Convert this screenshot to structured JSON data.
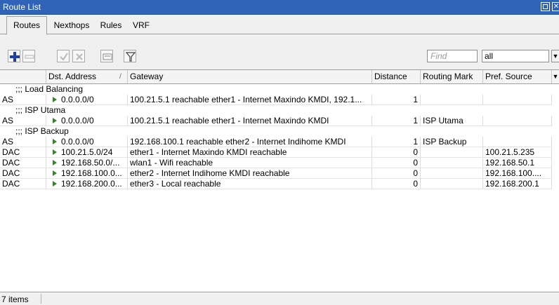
{
  "window": {
    "title": "Route List",
    "close_glyph": "✕"
  },
  "tabs": [
    {
      "label": "Routes",
      "active": true
    },
    {
      "label": "Nexthops",
      "active": false
    },
    {
      "label": "Rules",
      "active": false
    },
    {
      "label": "VRF",
      "active": false
    }
  ],
  "toolbar": {
    "buttons": [
      "add-icon",
      "remove-icon",
      "enable-icon",
      "disable-icon",
      "comment-icon",
      "filter-icon"
    ],
    "find_placeholder": "Find",
    "filter_value": "all",
    "dropdown_glyph": "▼"
  },
  "columns": {
    "flags": "",
    "dst": "Dst. Address",
    "sort": "/",
    "gateway": "Gateway",
    "distance": "Distance",
    "routing_mark": "Routing Mark",
    "pref_source": "Pref. Source",
    "menu_glyph": "▼"
  },
  "groups": [
    {
      "comment": ";;; Load Balancing",
      "row": {
        "flags": "AS",
        "dst": "0.0.0.0/0",
        "gateway": "100.21.5.1 reachable ether1 - Internet Maxindo KMDI, 192.1...",
        "distance": "1",
        "routing_mark": "",
        "pref_source": ""
      }
    },
    {
      "comment": ";;; ISP Utama",
      "row": {
        "flags": "AS",
        "dst": "0.0.0.0/0",
        "gateway": "100.21.5.1 reachable ether1 - Internet Maxindo KMDI",
        "distance": "1",
        "routing_mark": "ISP Utama",
        "pref_source": ""
      }
    },
    {
      "comment": ";;; ISP Backup",
      "row": {
        "flags": "AS",
        "dst": "0.0.0.0/0",
        "gateway": "192.168.100.1 reachable ether2 - Internet Indihome KMDI",
        "distance": "1",
        "routing_mark": "ISP Backup",
        "pref_source": ""
      }
    }
  ],
  "rows": [
    {
      "flags": "DAC",
      "dst": "100.21.5.0/24",
      "gateway": "ether1 - Internet Maxindo KMDI reachable",
      "distance": "0",
      "routing_mark": "",
      "pref_source": "100.21.5.235"
    },
    {
      "flags": "DAC",
      "dst": "192.168.50.0/...",
      "gateway": "wlan1 - Wifi reachable",
      "distance": "0",
      "routing_mark": "",
      "pref_source": "192.168.50.1"
    },
    {
      "flags": "DAC",
      "dst": "192.168.100.0...",
      "gateway": "ether2 - Internet Indihome KMDI reachable",
      "distance": "0",
      "routing_mark": "",
      "pref_source": "192.168.100...."
    },
    {
      "flags": "DAC",
      "dst": "192.168.200.0...",
      "gateway": "ether3 - Local reachable",
      "distance": "0",
      "routing_mark": "",
      "pref_source": "192.168.200.1"
    }
  ],
  "status": {
    "count_text": "7 items"
  },
  "colors": {
    "titlebar": "#2f64b8",
    "active_route_arrow": "#2e8b1f",
    "add_icon": "#1e3fa8"
  }
}
